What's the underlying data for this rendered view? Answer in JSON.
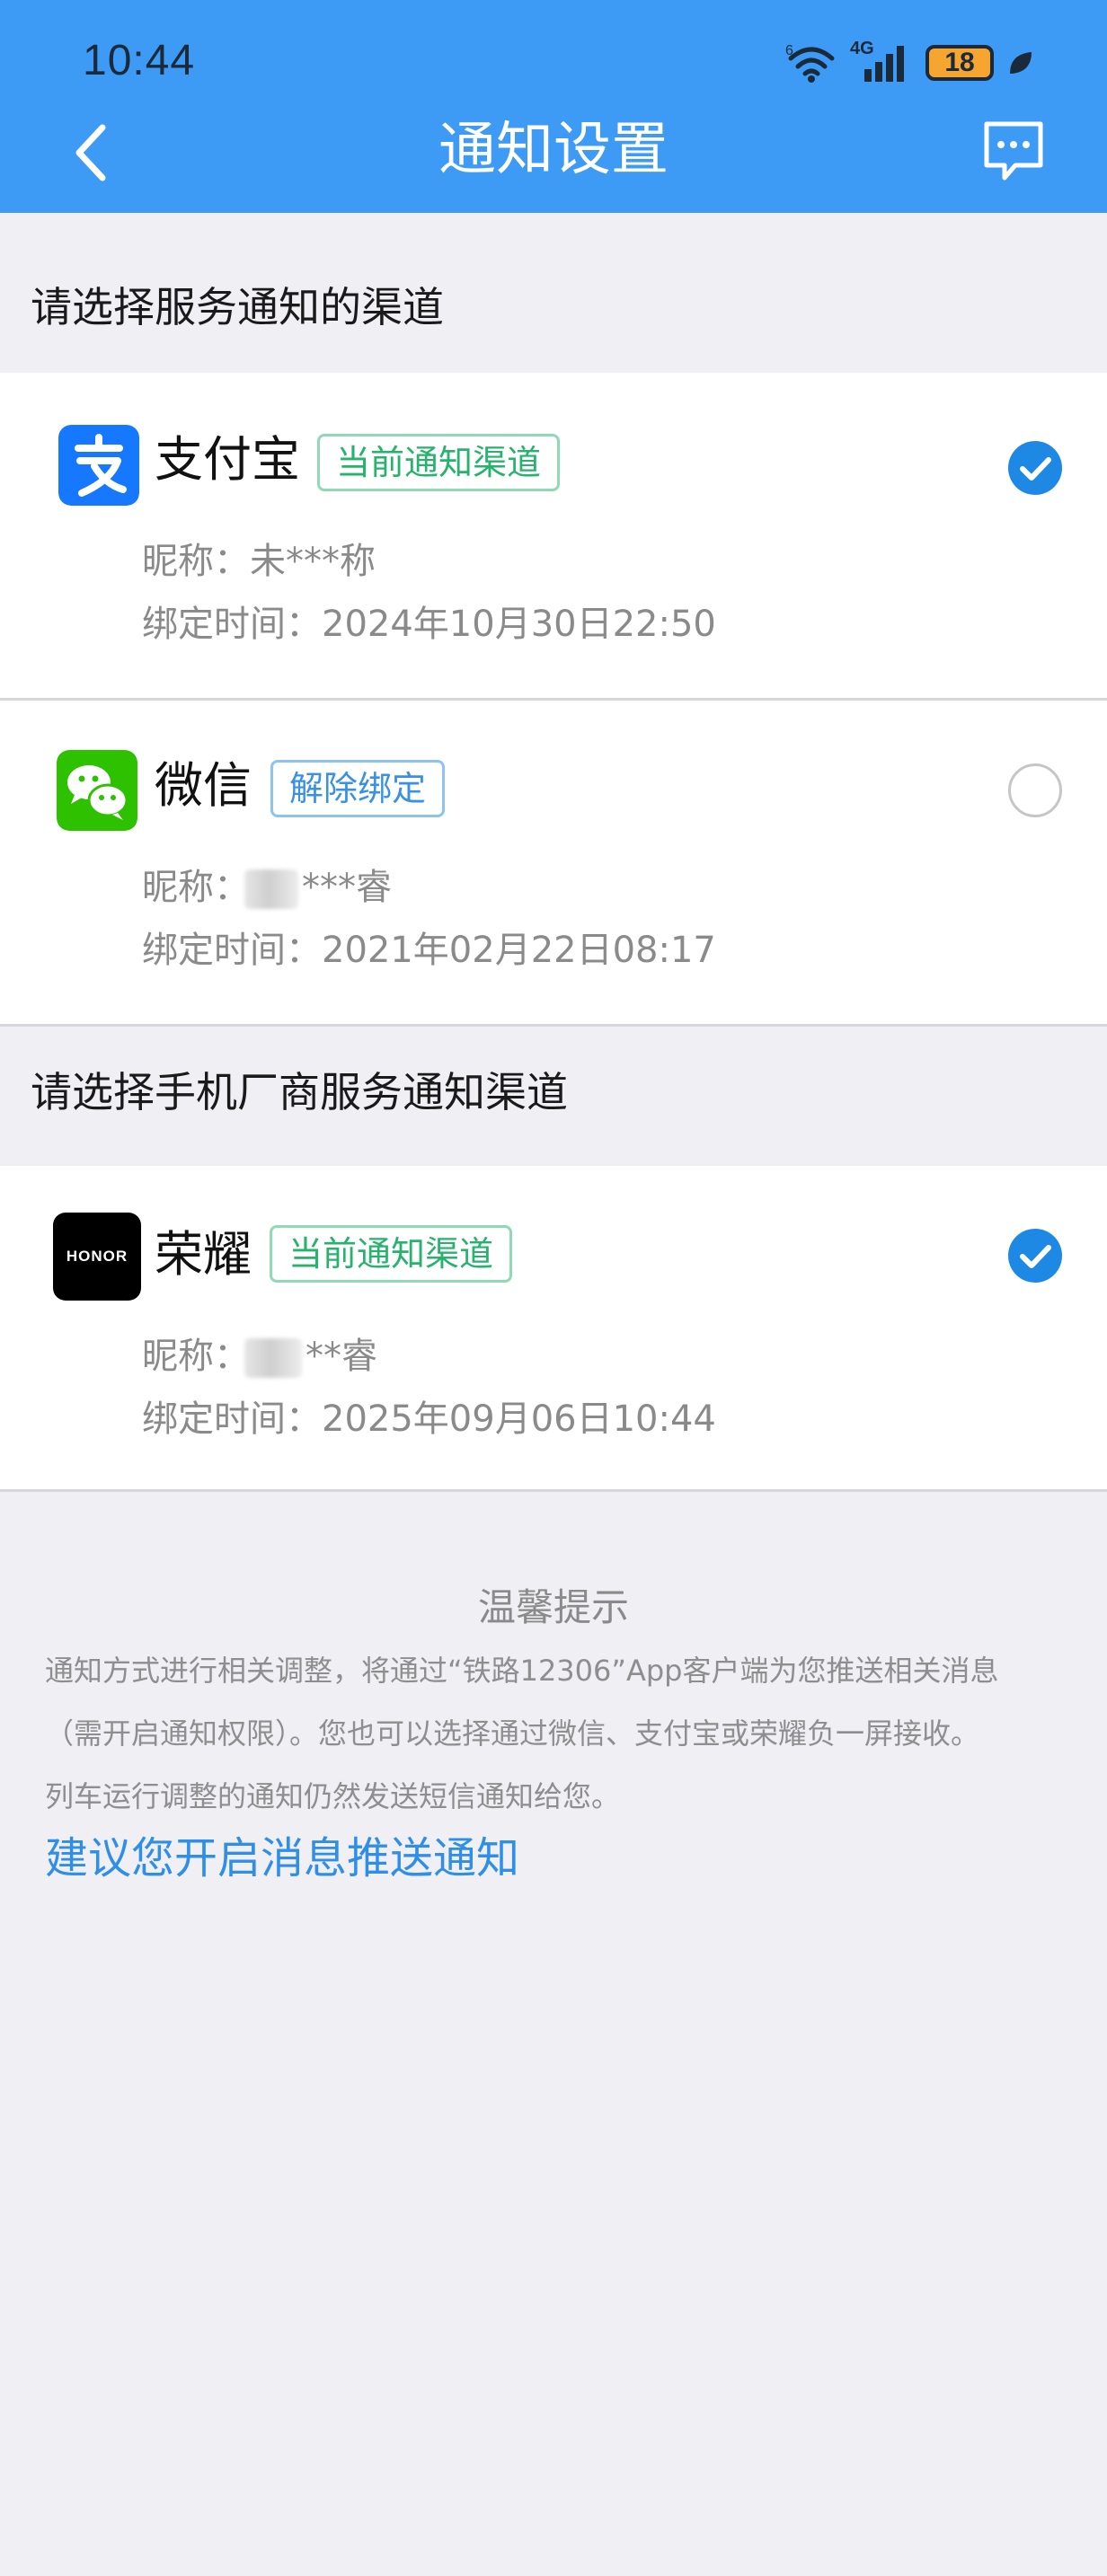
{
  "status_bar": {
    "time": "10:44",
    "network": "4G",
    "battery": "18",
    "signal_badge": "6"
  },
  "nav": {
    "title": "通知设置",
    "back_icon": "chevron-left-icon",
    "message_icon": "chat-bubble-icon"
  },
  "service_section": {
    "title": "请选择服务通知的渠道",
    "channels": [
      {
        "name": "支付宝",
        "tag": "当前通知渠道",
        "nickname_label": "昵称：",
        "nickname": "未***称",
        "bind_label": "绑定时间：",
        "bind_time": "2024年10月30日22:50",
        "selected": true,
        "brand_color": "#1677ff",
        "icon": "alipay-icon"
      },
      {
        "name": "微信",
        "tag": "解除绑定",
        "nickname_label": "昵称：",
        "nickname": "***睿",
        "bind_label": "绑定时间：",
        "bind_time": "2021年02月22日08:17",
        "selected": false,
        "brand_color": "#2dc100",
        "icon": "wechat-icon"
      }
    ]
  },
  "vendor_section": {
    "title": "请选择手机厂商服务通知渠道",
    "channels": [
      {
        "name": "荣耀",
        "logo_text": "HONOR",
        "tag": "当前通知渠道",
        "nickname_label": "昵称：",
        "nickname": "**睿",
        "bind_label": "绑定时间：",
        "bind_time": "2025年09月06日10:44",
        "selected": true,
        "brand_color": "#000000",
        "icon": "honor-icon"
      }
    ]
  },
  "tips": {
    "title": "温馨提示",
    "lines": [
      "通知方式进行相关调整，将通过“铁路12306”App客户端为您推送相关消息",
      "（需开启通知权限）。您也可以选择通过微信、支付宝或荣耀负一屏接收。",
      "列车运行调整的通知仍然发送短信通知给您。"
    ],
    "link": "建议您开启消息推送通知"
  },
  "colors": {
    "header": "#3d9bf5",
    "background": "#efeff4",
    "accent": "#1e88e5",
    "tag_green": "#27b26e",
    "tag_blue": "#3991e3"
  }
}
